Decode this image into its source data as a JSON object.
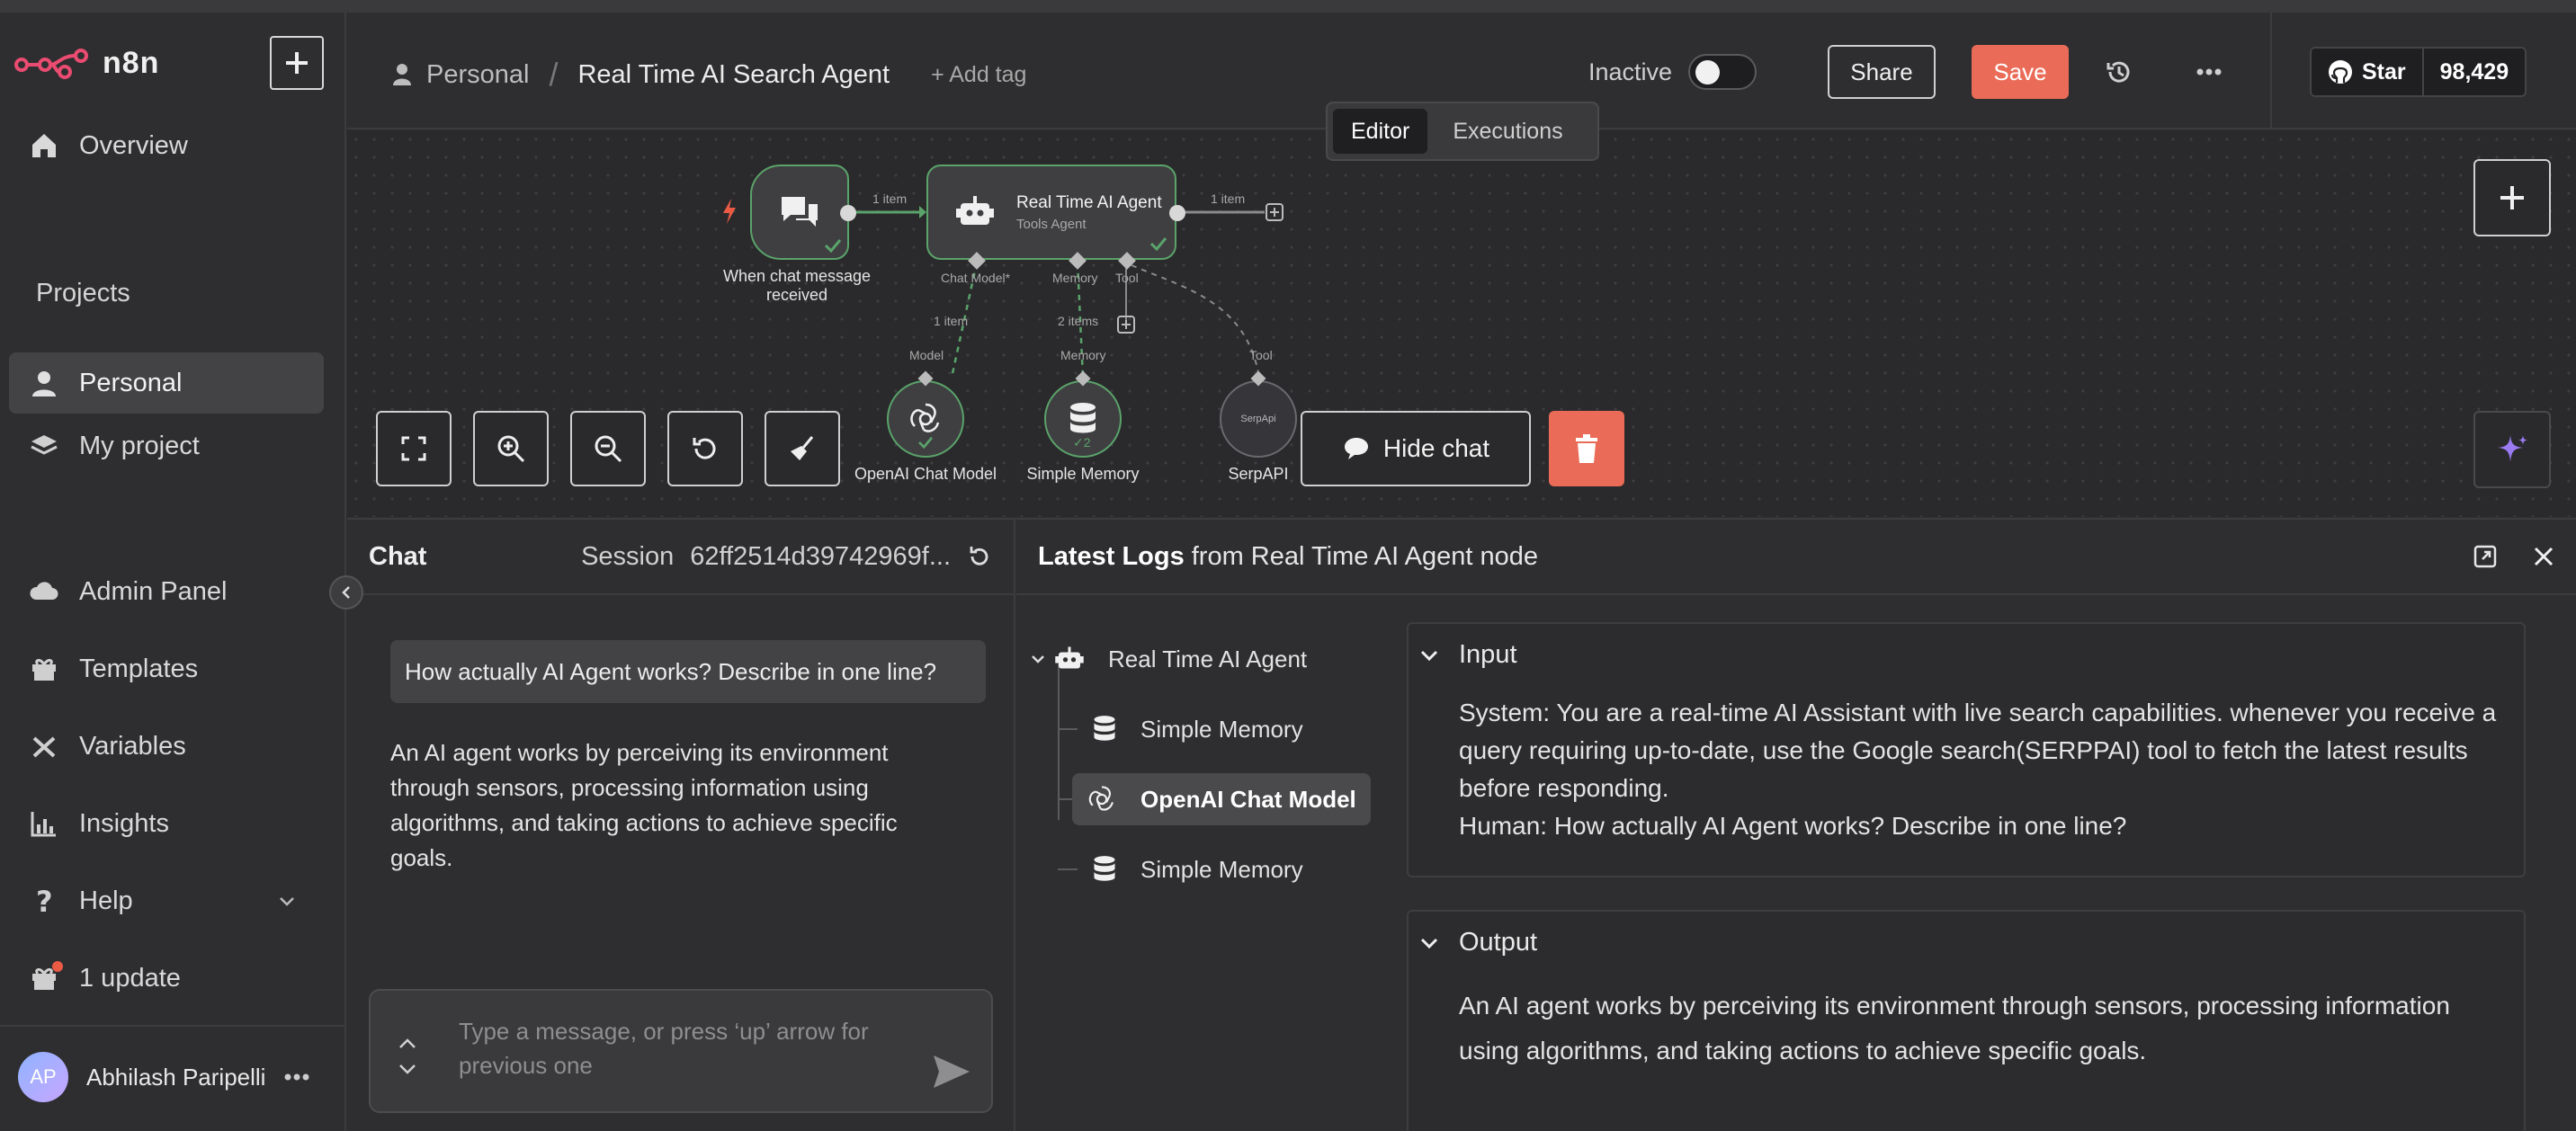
{
  "app": {
    "brand": "n8n"
  },
  "sidebar": {
    "overview": "Overview",
    "projects_heading": "Projects",
    "items": [
      {
        "label": "Personal"
      },
      {
        "label": "My project"
      }
    ],
    "bottom": [
      {
        "label": "Admin Panel"
      },
      {
        "label": "Templates"
      },
      {
        "label": "Variables"
      },
      {
        "label": "Insights"
      },
      {
        "label": "Help"
      },
      {
        "label": "1 update"
      }
    ],
    "user": {
      "initials": "AP",
      "name": "Abhilash Paripelli"
    }
  },
  "header": {
    "project": "Personal",
    "separator": "/",
    "workflow_title": "Real Time AI Search Agent",
    "add_tag": "+ Add tag",
    "status_label": "Inactive",
    "share_label": "Share",
    "save_label": "Save",
    "github": {
      "star_label": "Star",
      "count": "98,429"
    }
  },
  "canvas": {
    "tabs": [
      {
        "label": "Editor"
      },
      {
        "label": "Executions"
      }
    ],
    "nodes": {
      "trigger": {
        "label_line1": "When chat message",
        "label_line2": "received"
      },
      "agent": {
        "title": "Real Time AI Agent",
        "subtitle": "Tools Agent"
      },
      "openai": {
        "label": "OpenAI Chat Model"
      },
      "memory": {
        "label": "Simple Memory",
        "badge": "2"
      },
      "serp": {
        "label": "SerpAPI",
        "inner": "SerpApi"
      }
    },
    "edges": {
      "trigger_agent": "1 item",
      "agent_out": "1 item",
      "chat_model": "1 item",
      "memory": "2 items"
    },
    "ports": {
      "chat_model": "Chat Model*",
      "memory": "Memory",
      "tool": "Tool",
      "model_in": "Model",
      "memory_in": "Memory",
      "tool_in": "Tool"
    },
    "hide_chat_label": "Hide chat"
  },
  "chat": {
    "title": "Chat",
    "session_label": "Session",
    "session_id": "62ff2514d39742969f...",
    "user_message": "How actually AI Agent works? Describe in one line?",
    "bot_message": "An AI agent works by perceiving its environment through sensors, processing information using algorithms, and taking actions to achieve specific goals.",
    "input_placeholder": "Type a message, or press ‘up’ arrow for previous one"
  },
  "logs": {
    "title_bold": "Latest Logs",
    "title_rest": "from Real Time AI Agent node",
    "tree": [
      {
        "label": "Real Time AI Agent"
      },
      {
        "label": "Simple Memory"
      },
      {
        "label": "OpenAI Chat Model"
      },
      {
        "label": "Simple Memory"
      }
    ],
    "input": {
      "heading": "Input",
      "system": "System: You are a real-time AI Assistant with live search capabilities. whenever you receive a query requiring up-to-date, use the Google search(SERPPAI) tool to fetch the latest results before responding.",
      "human": "Human: How actually AI Agent works? Describe in one line?"
    },
    "output": {
      "heading": "Output",
      "text": "An AI agent works by perceiving its environment through sensors, processing information using algorithms, and taking actions to achieve specific goals."
    }
  },
  "colors": {
    "accent": "#ea6b58",
    "success": "#5aa36a",
    "brand": "#ea4b71"
  },
  "icons": [
    "n8n-logo",
    "plus-icon",
    "home-icon",
    "user-icon",
    "layers-icon",
    "cloud-icon",
    "gift-box-icon",
    "variable-icon",
    "chart-icon",
    "help-icon",
    "chevron-down-icon",
    "history-icon",
    "more-icon",
    "github-icon",
    "chat-bubbles-icon",
    "robot-icon",
    "openai-icon",
    "database-icon",
    "fit-view-icon",
    "zoom-in-icon",
    "zoom-out-icon",
    "reset-icon",
    "broom-icon",
    "trash-icon",
    "sparkle-icon",
    "refresh-icon",
    "popout-icon",
    "close-icon",
    "send-icon"
  ]
}
